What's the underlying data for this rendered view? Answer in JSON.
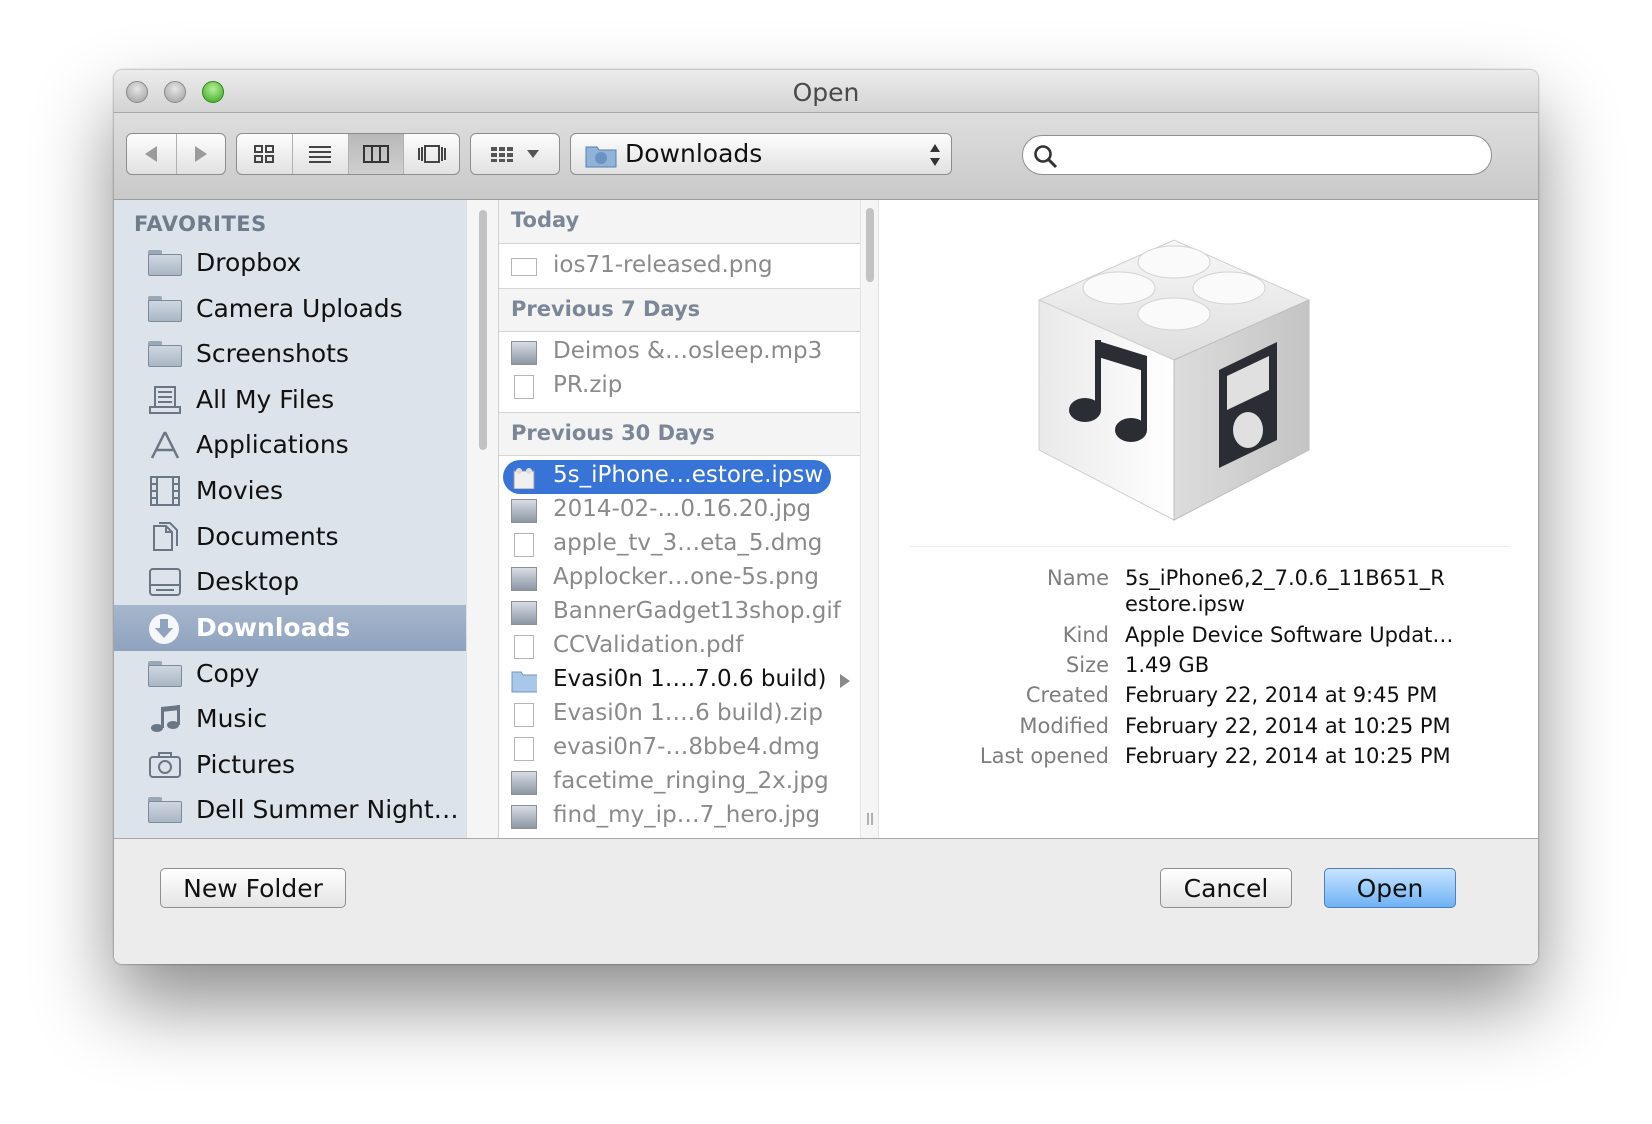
{
  "window": {
    "title": "Open"
  },
  "toolbar": {
    "location": "Downloads",
    "search_placeholder": ""
  },
  "sidebar": {
    "heading": "FAVORITES",
    "items": [
      {
        "label": "Dropbox",
        "icon": "folder-icon"
      },
      {
        "label": "Camera Uploads",
        "icon": "folder-icon"
      },
      {
        "label": "Screenshots",
        "icon": "folder-icon"
      },
      {
        "label": "All My Files",
        "icon": "all-files-icon"
      },
      {
        "label": "Applications",
        "icon": "applications-icon"
      },
      {
        "label": "Movies",
        "icon": "film-icon"
      },
      {
        "label": "Documents",
        "icon": "documents-icon"
      },
      {
        "label": "Desktop",
        "icon": "desktop-icon"
      },
      {
        "label": "Downloads",
        "icon": "download-icon",
        "selected": true
      },
      {
        "label": "Copy",
        "icon": "folder-icon"
      },
      {
        "label": "Music",
        "icon": "music-note-icon"
      },
      {
        "label": "Pictures",
        "icon": "camera-icon"
      },
      {
        "label": "Dell Summer Night…",
        "icon": "folder-icon"
      }
    ]
  },
  "files": {
    "groups": [
      "Today",
      "Previous 7 Days",
      "Previous 30 Days"
    ],
    "today": [
      "ios71-released.png"
    ],
    "prev7": [
      "Deimos &…osleep.mp3",
      "PR.zip"
    ],
    "prev30": [
      "5s_iPhone…estore.ipsw",
      "2014-02-…0.16.20.jpg",
      "apple_tv_3…eta_5.dmg",
      "Applocker…one-5s.png",
      "BannerGadget13shop.gif",
      "CCValidation.pdf",
      "Evasi0n 1….7.0.6 build)",
      "Evasi0n 1….6 build).zip",
      "evasi0n7-…8bbe4.dmg",
      "facetime_ringing_2x.jpg",
      "find_my_ip…7_hero.jpg"
    ]
  },
  "preview": {
    "labels": [
      "Name",
      "Kind",
      "Size",
      "Created",
      "Modified",
      "Last opened"
    ],
    "name_line1": "5s_iPhone6,2_7.0.6_11B651_R",
    "name_line2": "estore.ipsw",
    "kind": "Apple Device Software Updat…",
    "size": "1.49 GB",
    "created": "February 22, 2014 at 9:45 PM",
    "modified": "February 22, 2014 at 10:25 PM",
    "last_opened": "February 22, 2014 at 10:25 PM"
  },
  "buttons": {
    "new_folder": "New Folder",
    "cancel": "Cancel",
    "open": "Open"
  },
  "colors": {
    "selection": "#3874d8",
    "sidebar_bg": "#dde3ea",
    "primary_button": "#6fb2f4"
  }
}
